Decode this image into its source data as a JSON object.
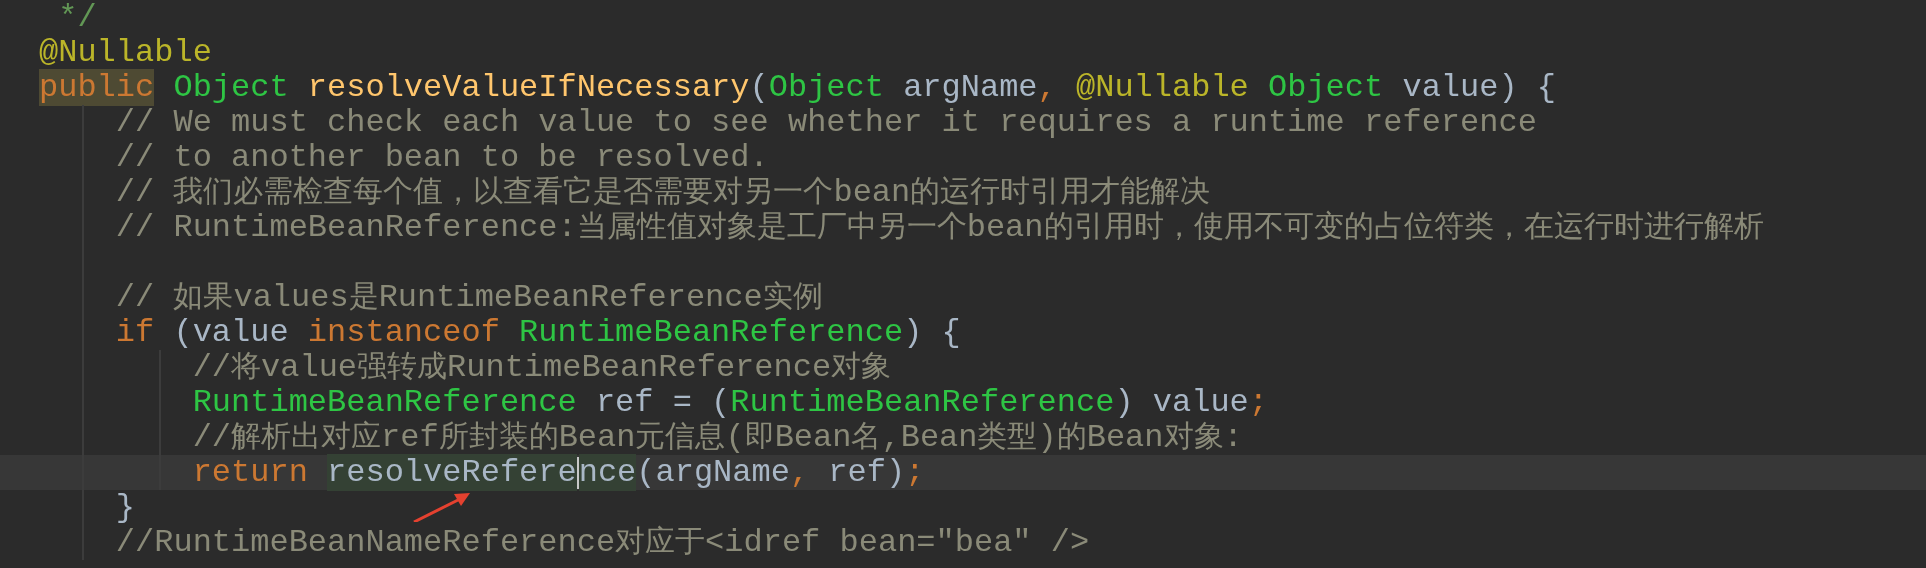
{
  "editor": {
    "lines": [
      {
        "kind": "code",
        "current": false,
        "tokens": [
          {
            "kind": "doc",
            "text": " */",
            "highlighted": false
          }
        ]
      },
      {
        "kind": "code",
        "current": false,
        "tokens": [
          {
            "kind": "annotation",
            "text": "@Nullable",
            "highlighted": false
          }
        ]
      },
      {
        "kind": "code",
        "current": false,
        "tokens": [
          {
            "kind": "keyword",
            "text": "public",
            "highlighted": true
          },
          {
            "kind": "type",
            "text": " Object",
            "highlighted": false
          },
          {
            "kind": "method",
            "text": " resolveValueIfNecessary",
            "highlighted": false
          },
          {
            "kind": "plain",
            "text": "(",
            "highlighted": false
          },
          {
            "kind": "type",
            "text": "Object",
            "highlighted": false
          },
          {
            "kind": "plain",
            "text": " argName",
            "highlighted": false
          },
          {
            "kind": "punct",
            "text": ",",
            "highlighted": false
          },
          {
            "kind": "annotation",
            "text": " @Nullable",
            "highlighted": false
          },
          {
            "kind": "type",
            "text": " Object",
            "highlighted": false
          },
          {
            "kind": "plain",
            "text": " value) {",
            "highlighted": false
          }
        ]
      },
      {
        "kind": "code",
        "current": false,
        "tokens": [
          {
            "kind": "comment",
            "text": "    // We must check each value to see whether it requires a runtime reference",
            "highlighted": false
          }
        ]
      },
      {
        "kind": "code",
        "current": false,
        "tokens": [
          {
            "kind": "comment",
            "text": "    // to another bean to be resolved.",
            "highlighted": false
          }
        ]
      },
      {
        "kind": "code",
        "current": false,
        "tokens": [
          {
            "kind": "comment",
            "text": "    // 我们必需检查每个值，以查看它是否需要对另一个bean的运行时引用才能解决",
            "highlighted": false
          }
        ]
      },
      {
        "kind": "code",
        "current": false,
        "tokens": [
          {
            "kind": "comment",
            "text": "    // RuntimeBeanReference:当属性值对象是工厂中另一个bean的引用时，使用不可变的占位符类，在运行时进行解析",
            "highlighted": false
          }
        ]
      },
      {
        "kind": "blank",
        "current": false
      },
      {
        "kind": "code",
        "current": false,
        "tokens": [
          {
            "kind": "comment",
            "text": "    // 如果values是RuntimeBeanReference实例",
            "highlighted": false
          }
        ]
      },
      {
        "kind": "code",
        "current": false,
        "tokens": [
          {
            "kind": "keyword",
            "text": "    if",
            "highlighted": false
          },
          {
            "kind": "plain",
            "text": " (value ",
            "highlighted": false
          },
          {
            "kind": "keyword",
            "text": "instanceof",
            "highlighted": false
          },
          {
            "kind": "type",
            "text": " RuntimeBeanReference",
            "highlighted": false
          },
          {
            "kind": "plain",
            "text": ") {",
            "highlighted": false
          }
        ]
      },
      {
        "kind": "code",
        "current": false,
        "tokens": [
          {
            "kind": "comment",
            "text": "        //将value强转成RuntimeBeanReference对象",
            "highlighted": false
          }
        ]
      },
      {
        "kind": "code",
        "current": false,
        "tokens": [
          {
            "kind": "type",
            "text": "        RuntimeBeanReference",
            "highlighted": false
          },
          {
            "kind": "plain",
            "text": " ref = (",
            "highlighted": false
          },
          {
            "kind": "type",
            "text": "RuntimeBeanReference",
            "highlighted": false
          },
          {
            "kind": "plain",
            "text": ") value",
            "highlighted": false
          },
          {
            "kind": "punct",
            "text": ";",
            "highlighted": false
          }
        ]
      },
      {
        "kind": "code",
        "current": false,
        "tokens": [
          {
            "kind": "comment",
            "text": "        //解析出对应ref所封装的Bean元信息(即Bean名,Bean类型)的Bean对象:",
            "highlighted": false
          }
        ]
      },
      {
        "kind": "code",
        "current": true,
        "tokens": [
          {
            "kind": "keyword",
            "text": "        return ",
            "highlighted": false
          },
          {
            "kind": "plain",
            "text": "resolveRefere",
            "highlighted": true
          },
          {
            "kind": "caret"
          },
          {
            "kind": "plain",
            "text": "nce",
            "highlighted": true
          },
          {
            "kind": "plain",
            "text": "(argName",
            "highlighted": false
          },
          {
            "kind": "punct",
            "text": ",",
            "highlighted": false
          },
          {
            "kind": "plain",
            "text": " ref)",
            "highlighted": false
          },
          {
            "kind": "punct",
            "text": ";",
            "highlighted": false
          }
        ]
      },
      {
        "kind": "code",
        "current": false,
        "tokens": [
          {
            "kind": "plain",
            "text": "    }",
            "highlighted": false
          }
        ]
      },
      {
        "kind": "code",
        "current": false,
        "tokens": [
          {
            "kind": "comment",
            "text": "    //RuntimeBeanNameReference对应于<idref bean=\"bea\" />",
            "highlighted": false
          }
        ]
      }
    ]
  }
}
